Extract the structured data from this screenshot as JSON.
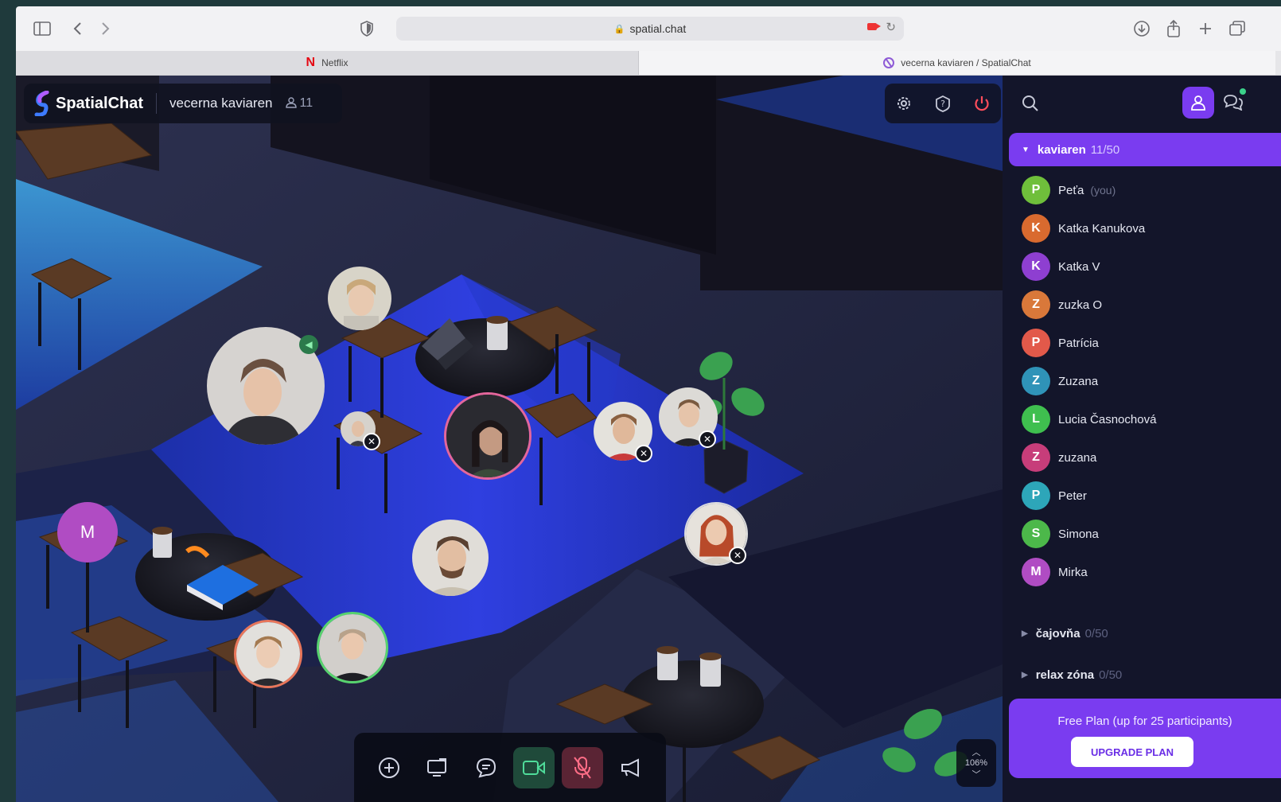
{
  "browser": {
    "url": "spatial.chat",
    "tabs": [
      {
        "label": "Netflix",
        "active": false
      },
      {
        "label": "vecerna kaviaren / SpatialChat",
        "active": true
      }
    ]
  },
  "header": {
    "brand": "SpatialChat",
    "room_name": "vecerna kaviaren",
    "participant_count": "11"
  },
  "scene": {
    "avatar_letter": "M",
    "zoom": "106%"
  },
  "sidebar": {
    "active_room": {
      "name": "kaviaren",
      "count": "11/50"
    },
    "members": [
      {
        "letter": "P",
        "name": "Peťa",
        "suffix": "(you)",
        "color": "#6fbf3b"
      },
      {
        "letter": "K",
        "name": "Katka Kanukova",
        "suffix": "",
        "color": "#d96a2f"
      },
      {
        "letter": "K",
        "name": "Katka V",
        "suffix": "",
        "color": "#8e3fd1"
      },
      {
        "letter": "Z",
        "name": "zuzka O",
        "suffix": "",
        "color": "#d9783a"
      },
      {
        "letter": "P",
        "name": "Patrícia",
        "suffix": "",
        "color": "#e2594a"
      },
      {
        "letter": "Z",
        "name": "Zuzana",
        "suffix": "",
        "color": "#2f93b8"
      },
      {
        "letter": "L",
        "name": "Lucia Časnochová",
        "suffix": "",
        "color": "#3fbf4f"
      },
      {
        "letter": "Z",
        "name": "zuzana",
        "suffix": "",
        "color": "#c73d7a"
      },
      {
        "letter": "P",
        "name": "Peter",
        "suffix": "",
        "color": "#2da6b9"
      },
      {
        "letter": "S",
        "name": "Simona",
        "suffix": "",
        "color": "#4cb84a"
      },
      {
        "letter": "M",
        "name": "Mirka",
        "suffix": "",
        "color": "#b04cc3"
      }
    ],
    "other_rooms": [
      {
        "name": "čajovňa",
        "count": "0/50"
      },
      {
        "name": "relax zóna",
        "count": "0/50"
      }
    ],
    "plan": {
      "text": "Free Plan (up for 25 participants)",
      "button": "UPGRADE PLAN"
    }
  },
  "colors": {
    "accent": "#7a3cf0",
    "sidebar_bg": "#13152a",
    "power": "#ff4d5b"
  },
  "icons": [
    "sidebar-toggle-icon",
    "back-icon",
    "forward-icon",
    "shield-icon",
    "lock-icon",
    "camera-icon",
    "reload-icon",
    "download-icon",
    "share-icon",
    "new-tab-icon",
    "tabs-icon",
    "settings-icon",
    "help-icon",
    "power-icon",
    "search-icon",
    "people-icon",
    "chat-icon",
    "add-icon",
    "screen-share-icon",
    "message-icon",
    "video-icon",
    "mic-off-icon",
    "megaphone-icon"
  ]
}
